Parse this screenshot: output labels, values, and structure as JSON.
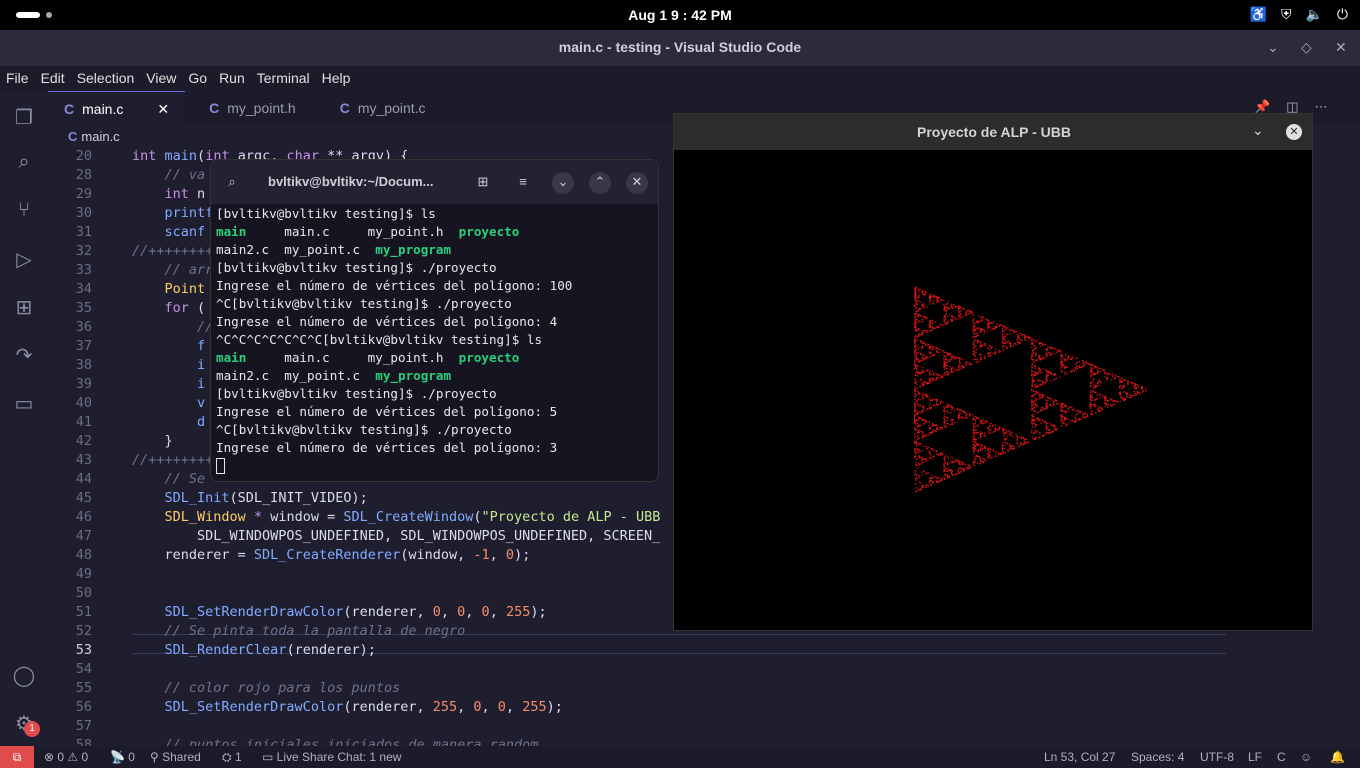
{
  "topbar": {
    "clock": "Aug 1    9 : 42 PM"
  },
  "window": {
    "title": "main.c - testing - Visual Studio Code"
  },
  "menu": [
    "File",
    "Edit",
    "Selection",
    "View",
    "Go",
    "Run",
    "Terminal",
    "Help"
  ],
  "tabs": [
    {
      "label": "main.c",
      "active": true
    },
    {
      "label": "my_point.h",
      "active": false
    },
    {
      "label": "my_point.c",
      "active": false
    }
  ],
  "breadcrumb": "main.c",
  "editor": {
    "lines": [
      {
        "n": "20",
        "html": "<span class=\"kw\">int</span> <span class=\"fn\">main</span>(<span class=\"kw\">int</span> argc, <span class=\"kw\">char</span> ** argv) {"
      },
      {
        "n": "28",
        "html": "    <span class=\"cm\">// va</span>"
      },
      {
        "n": "29",
        "html": "    <span class=\"kw\">int</span> n"
      },
      {
        "n": "30",
        "html": "    <span class=\"fn\">printf</span>"
      },
      {
        "n": "31",
        "html": "    <span class=\"fn\">scanf</span>"
      },
      {
        "n": "32",
        "html": "<span class=\"cm\">//++++++++</span>"
      },
      {
        "n": "33",
        "html": "    <span class=\"cm\">// arr</span>"
      },
      {
        "n": "34",
        "html": "    <span class=\"ty\">Point</span>"
      },
      {
        "n": "35",
        "html": "    <span class=\"kw\">for</span> ("
      },
      {
        "n": "36",
        "html": "        <span class=\"cm\">//</span>"
      },
      {
        "n": "37",
        "html": "        <span class=\"fn\">f</span>"
      },
      {
        "n": "38",
        "html": "        <span class=\"fn\">i</span>"
      },
      {
        "n": "39",
        "html": "        <span class=\"fn\">i</span>"
      },
      {
        "n": "40",
        "html": "        <span class=\"fn\">v</span>"
      },
      {
        "n": "41",
        "html": "        <span class=\"fn\">d</span>"
      },
      {
        "n": "42",
        "html": "    }"
      },
      {
        "n": "43",
        "html": "<span class=\"cm\">//++++++++</span>"
      },
      {
        "n": "44",
        "html": "    <span class=\"cm\">// Se</span>"
      },
      {
        "n": "45",
        "html": "    <span class=\"fn\">SDL_Init</span>(SDL_INIT_VIDEO);"
      },
      {
        "n": "46",
        "html": "    <span class=\"ty\">SDL_Window</span> <span class=\"kw\">*</span> window = <span class=\"fn\">SDL_CreateWindow</span>(<span class=\"str\">\"Proyecto de ALP - UBB</span>"
      },
      {
        "n": "47",
        "html": "        SDL_WINDOWPOS_UNDEFINED, SDL_WINDOWPOS_UNDEFINED, SCREEN_"
      },
      {
        "n": "48",
        "html": "    renderer = <span class=\"fn\">SDL_CreateRenderer</span>(window, <span class=\"num\">-1</span>, <span class=\"num\">0</span>);"
      },
      {
        "n": "49",
        "html": ""
      },
      {
        "n": "50",
        "html": ""
      },
      {
        "n": "51",
        "html": "    <span class=\"fn\">SDL_SetRenderDrawColor</span>(renderer, <span class=\"num\">0</span>, <span class=\"num\">0</span>, <span class=\"num\">0</span>, <span class=\"num\">255</span>);"
      },
      {
        "n": "52",
        "html": "    <span class=\"cm\">// Se pinta toda la pantalla de negro</span>"
      },
      {
        "n": "53",
        "html": "    <span class=\"fn\">SDL_RenderClear</span>(renderer);",
        "current": true
      },
      {
        "n": "54",
        "html": ""
      },
      {
        "n": "55",
        "html": "    <span class=\"cm\">// color rojo para los puntos</span>"
      },
      {
        "n": "56",
        "html": "    <span class=\"fn\">SDL_SetRenderDrawColor</span>(renderer, <span class=\"num\">255</span>, <span class=\"num\">0</span>, <span class=\"num\">0</span>, <span class=\"num\">255</span>);"
      },
      {
        "n": "57",
        "html": ""
      },
      {
        "n": "58",
        "html": "    <span class=\"cm\">// puntos iniciales iniciados de manera random</span>"
      }
    ]
  },
  "terminal": {
    "title": "bvltikv@bvltikv:~/Docum...",
    "lines": [
      {
        "t": "[bvltikv@bvltikv testing]$ ls"
      },
      {
        "parts": [
          [
            "main",
            "g"
          ],
          [
            "     main.c     my_point.h  ",
            ""
          ],
          [
            "proyecto",
            "g"
          ]
        ]
      },
      {
        "parts": [
          [
            "main2.c  my_point.c  ",
            ""
          ],
          [
            "my_program",
            "g"
          ]
        ]
      },
      {
        "t": "[bvltikv@bvltikv testing]$ ./proyecto"
      },
      {
        "t": "Ingrese el número de vértices del polígono: 100"
      },
      {
        "t": "^C[bvltikv@bvltikv testing]$ ./proyecto"
      },
      {
        "t": "Ingrese el número de vértices del polígono: 4"
      },
      {
        "t": "^C^C^C^C^C^C^C[bvltikv@bvltikv testing]$ ls"
      },
      {
        "parts": [
          [
            "main",
            "g"
          ],
          [
            "     main.c     my_point.h  ",
            ""
          ],
          [
            "proyecto",
            "g"
          ]
        ]
      },
      {
        "parts": [
          [
            "main2.c  my_point.c  ",
            ""
          ],
          [
            "my_program",
            "g"
          ]
        ]
      },
      {
        "t": "[bvltikv@bvltikv testing]$ ./proyecto"
      },
      {
        "t": "Ingrese el número de vértices del polígono: 5"
      },
      {
        "t": "^C[bvltikv@bvltikv testing]$ ./proyecto"
      },
      {
        "t": "Ingrese el número de vértices del polígono: 3"
      }
    ]
  },
  "sdl": {
    "title": "Proyecto de ALP - UBB"
  },
  "status": {
    "errors": "0",
    "warnings": "0",
    "ports": "0",
    "shared": "Shared",
    "participants": "1",
    "liveshare": "Live Share Chat: 1 new",
    "position": "Ln 53, Col 27",
    "spaces": "Spaces: 4",
    "encoding": "UTF-8",
    "eol": "LF",
    "lang": "C",
    "settings_badge": "1"
  }
}
